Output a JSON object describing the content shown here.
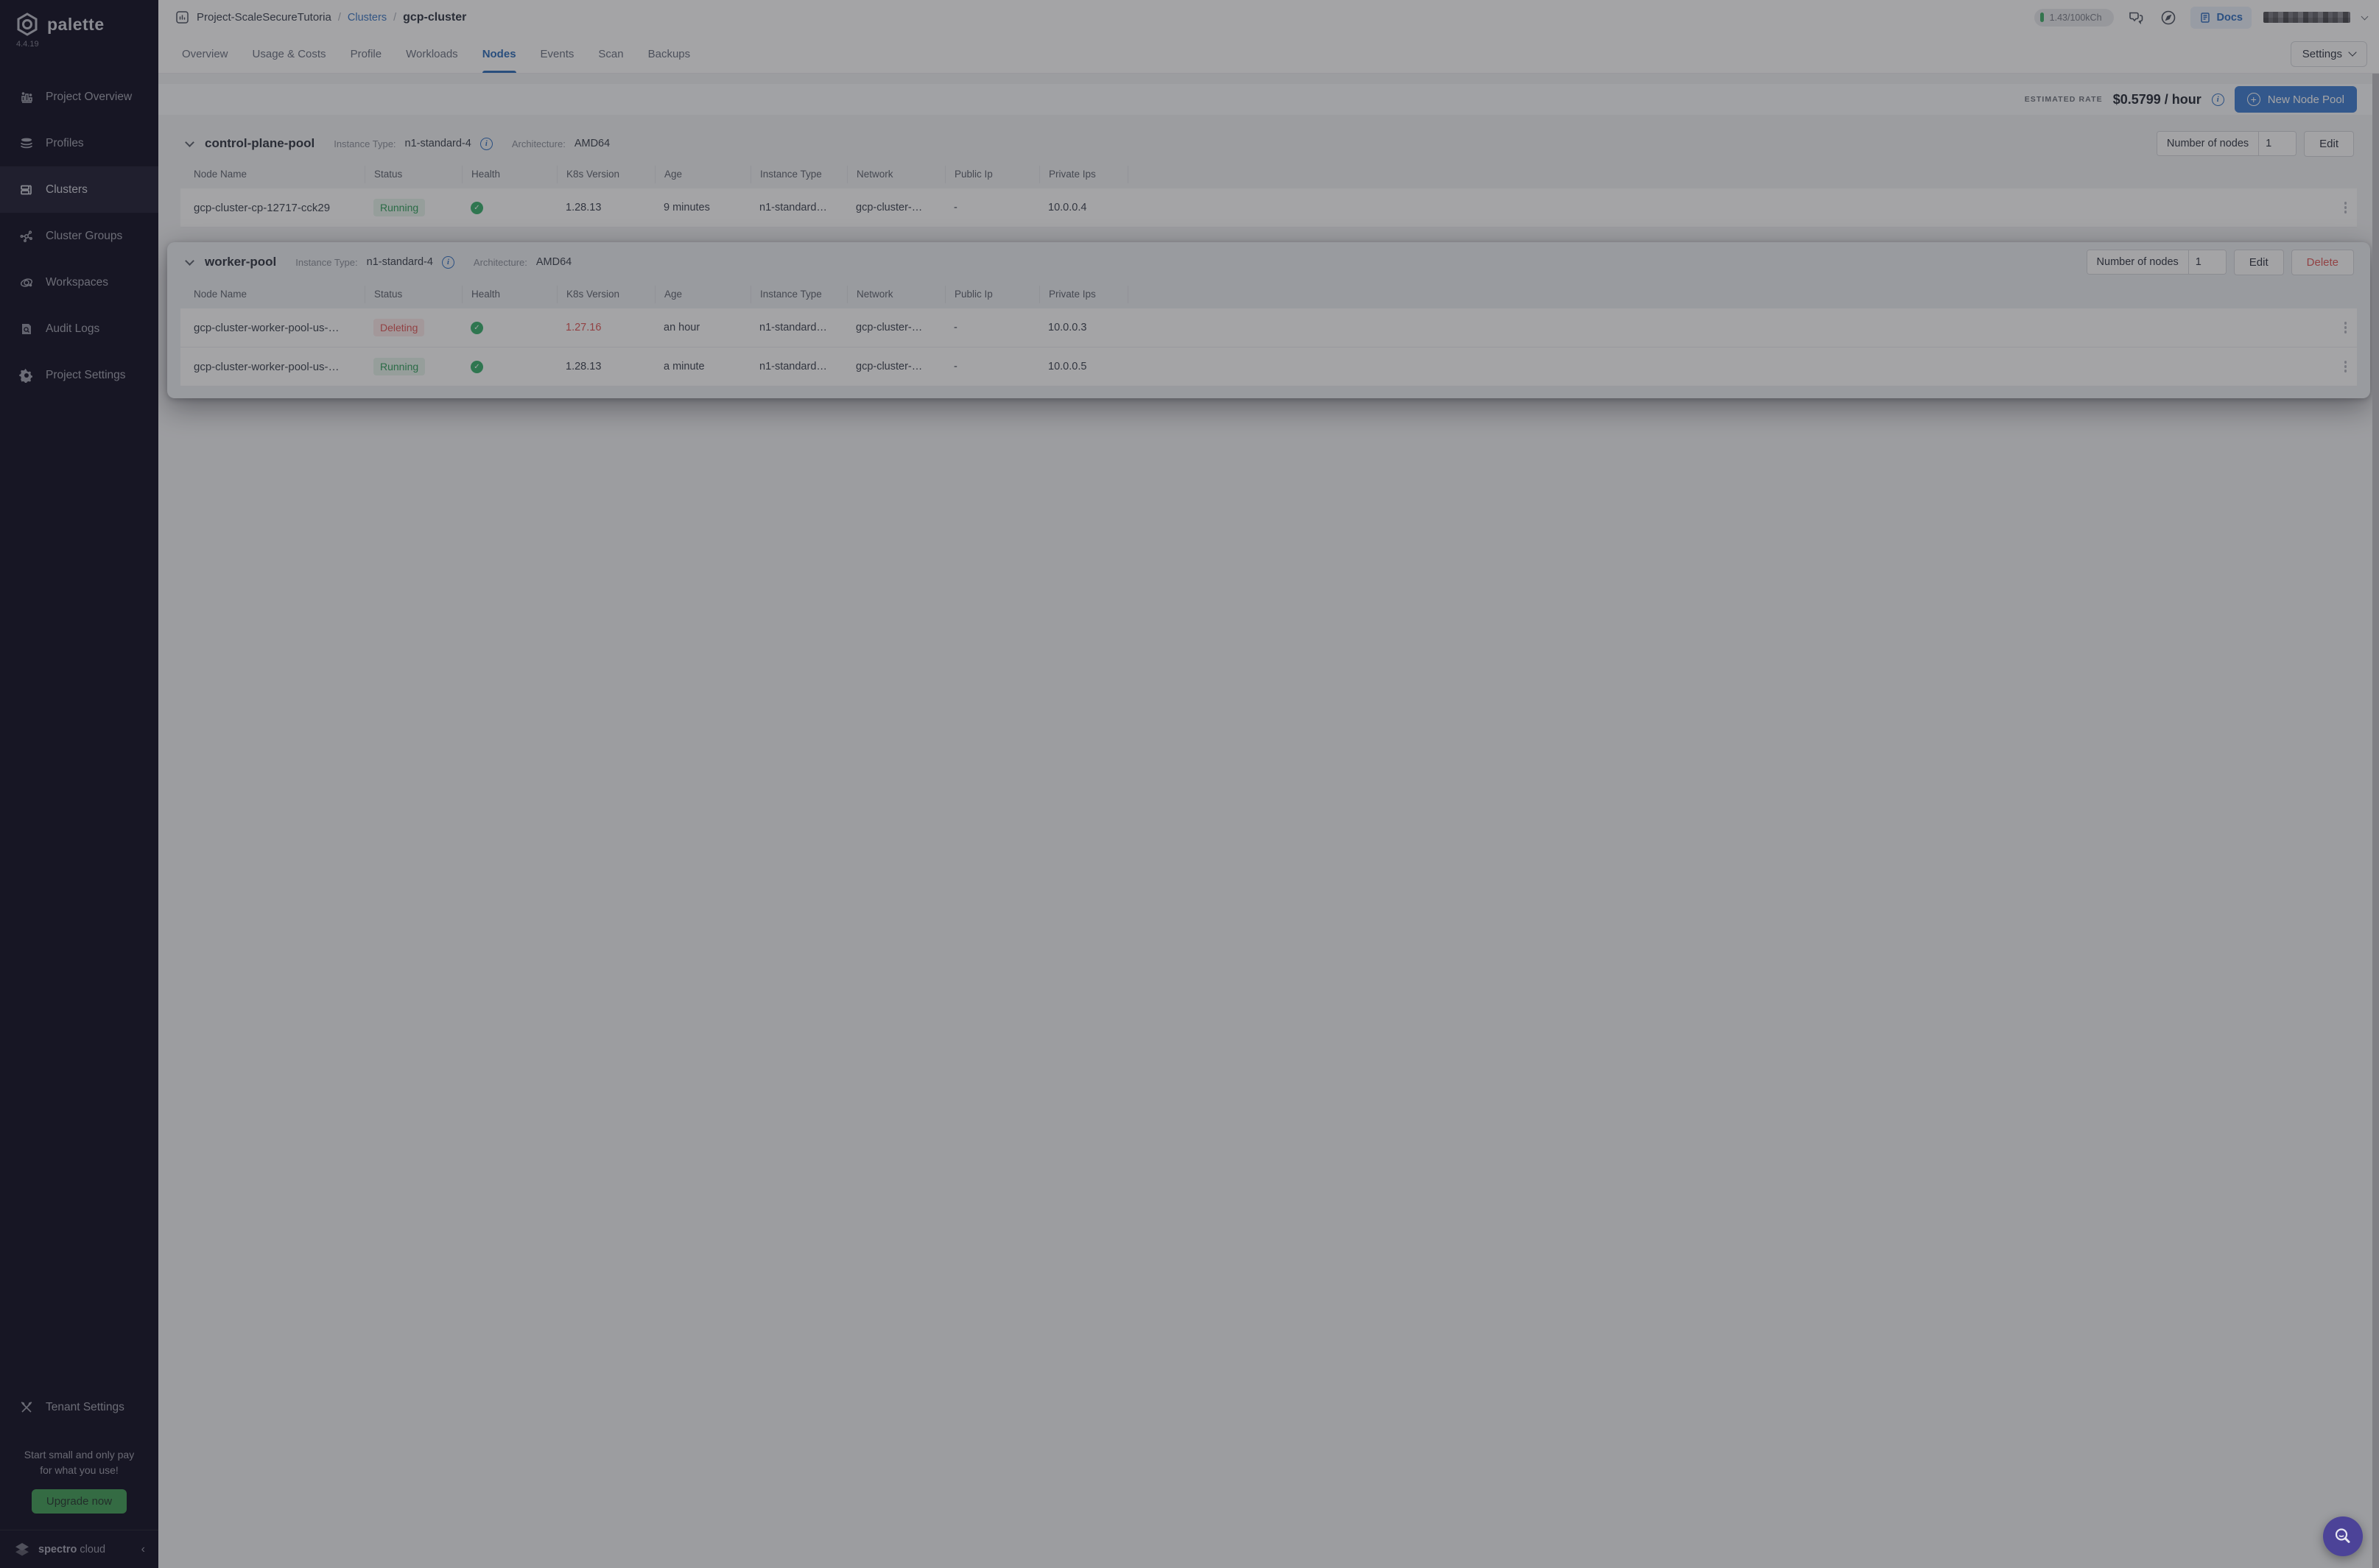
{
  "sidebar": {
    "logo": "palette",
    "version": "4.4.19",
    "items": [
      {
        "label": "Project Overview"
      },
      {
        "label": "Profiles"
      },
      {
        "label": "Clusters"
      },
      {
        "label": "Cluster Groups"
      },
      {
        "label": "Workspaces"
      },
      {
        "label": "Audit Logs"
      },
      {
        "label": "Project Settings"
      }
    ],
    "tenant_settings": "Tenant Settings",
    "promo_line1": "Start small and only pay",
    "promo_line2": "for what you use!",
    "upgrade": "Upgrade now",
    "brand_1": "spectro",
    "brand_2": "cloud"
  },
  "header": {
    "project": "Project-ScaleSecureTutoria",
    "sep": "/",
    "clusters_link": "Clusters",
    "cluster_name": "gcp-cluster",
    "usage": "1.43/100kCh",
    "docs": "Docs"
  },
  "tabs": [
    {
      "label": "Overview"
    },
    {
      "label": "Usage & Costs"
    },
    {
      "label": "Profile"
    },
    {
      "label": "Workloads"
    },
    {
      "label": "Nodes"
    },
    {
      "label": "Events"
    },
    {
      "label": "Scan"
    },
    {
      "label": "Backups"
    }
  ],
  "tabs_settings": "Settings",
  "toolbar": {
    "estimated_rate_label": "ESTIMATED RATE",
    "rate": "$0.5799 / hour",
    "info": "i",
    "new_node_pool": "New Node Pool"
  },
  "pools": {
    "columns": [
      "Node Name",
      "Status",
      "Health",
      "K8s Version",
      "Age",
      "Instance Type",
      "Network",
      "Public Ip",
      "Private Ips"
    ],
    "labels": {
      "instance_type": "Instance Type:",
      "architecture": "Architecture:",
      "number_of_nodes": "Number of nodes",
      "edit": "Edit",
      "delete": "Delete"
    },
    "control_plane": {
      "name": "control-plane-pool",
      "instance_type": "n1-standard-4",
      "architecture": "AMD64",
      "number_of_nodes": "1",
      "rows": [
        {
          "name": "gcp-cluster-cp-12717-cck29",
          "status": "Running",
          "k8s_version": "1.28.13",
          "age": "9 minutes",
          "instance_type": "n1-standard…",
          "network": "gcp-cluster-…",
          "public_ip": "-",
          "private_ips": "10.0.0.4"
        }
      ]
    },
    "worker": {
      "name": "worker-pool",
      "instance_type": "n1-standard-4",
      "architecture": "AMD64",
      "number_of_nodes": "1",
      "rows": [
        {
          "name": "gcp-cluster-worker-pool-us-…",
          "status": "Deleting",
          "k8s_version": "1.27.16",
          "age": "an hour",
          "instance_type": "n1-standard…",
          "network": "gcp-cluster-…",
          "public_ip": "-",
          "private_ips": "10.0.0.3"
        },
        {
          "name": "gcp-cluster-worker-pool-us-…",
          "status": "Running",
          "k8s_version": "1.28.13",
          "age": "a minute",
          "instance_type": "n1-standard…",
          "network": "gcp-cluster-…",
          "public_ip": "-",
          "private_ips": "10.0.0.5"
        }
      ]
    }
  },
  "colors": {
    "primary_blue": "#3d7dd2",
    "link_blue": "#2b6cb8",
    "status_green": "#2e9e5b",
    "status_red": "#e05656",
    "health_green": "#36b06b",
    "upgrade_green": "#3f9e55",
    "sidebar_bg": "#0d0b1f",
    "fab_purple": "#4c4398"
  }
}
